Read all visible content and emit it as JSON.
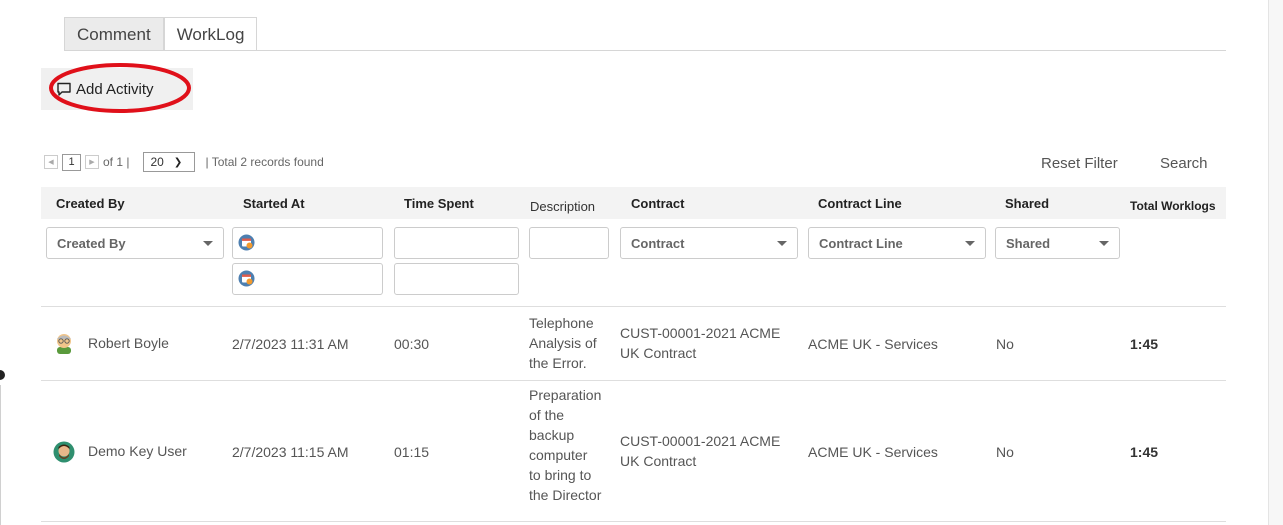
{
  "tabs": [
    {
      "label": "Comment",
      "active": false
    },
    {
      "label": "WorkLog",
      "active": true
    }
  ],
  "add_activity": {
    "label": "Add Activity",
    "icon": "comment-icon"
  },
  "pager": {
    "page": "1",
    "of_text": "of 1 |",
    "page_size": "20",
    "total_text": "| Total 2 records found"
  },
  "actions": {
    "reset_filter": "Reset Filter",
    "search": "Search"
  },
  "columns": {
    "created_by": "Created By",
    "started_at": "Started At",
    "time_spent": "Time Spent",
    "description": "Description",
    "contract": "Contract",
    "contract_line": "Contract Line",
    "shared": "Shared",
    "total_worklogs": "Total Worklogs"
  },
  "filters": {
    "created_by": "Created By",
    "contract": "Contract",
    "contract_line": "Contract Line",
    "shared": "Shared"
  },
  "rows": [
    {
      "created_by": "Robert Boyle",
      "started_at": "2/7/2023 11:31 AM",
      "time_spent": "00:30",
      "description": [
        "Telephone",
        "Analysis of",
        "the Error."
      ],
      "contract": [
        "CUST-00001-2021 ACME",
        "UK Contract"
      ],
      "contract_line": "ACME UK - Services",
      "shared": "No",
      "total_worklogs": "1:45"
    },
    {
      "created_by": "Demo Key User",
      "started_at": "2/7/2023 11:15 AM",
      "time_spent": "01:15",
      "description": [
        "Preparation",
        "of the",
        "backup",
        "computer",
        "to bring to",
        "the Director"
      ],
      "contract": [
        "CUST-00001-2021 ACME",
        "UK Contract"
      ],
      "contract_line": "ACME UK - Services",
      "shared": "No",
      "total_worklogs": "1:45"
    }
  ],
  "colors": {
    "highlight": "#e0101a",
    "header_bg": "#f3f3f3",
    "button_bg": "#f0f0f0"
  }
}
